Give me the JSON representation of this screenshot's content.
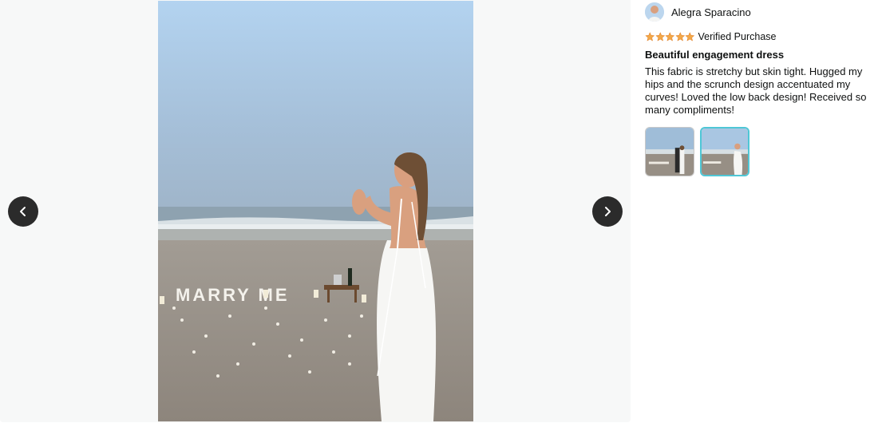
{
  "viewer": {
    "prev_icon": "chevron-left-icon",
    "next_icon": "chevron-right-icon",
    "photo_sign_text": "MARRY ME"
  },
  "review": {
    "reviewer_name": "Alegra Sparacino",
    "rating": 5,
    "rating_max": 5,
    "star_color": "#f3a847",
    "verified_label": "Verified Purchase",
    "title": "Beautiful engagement dress",
    "body": "This fabric is stretchy but skin tight. Hugged my hips and the scrunch design accentuated my curves! Loved the low back design! Received so many compliments!"
  },
  "thumbnails": {
    "count": 2,
    "selected_index": 1,
    "selected_border_color": "#4fc7d6"
  }
}
